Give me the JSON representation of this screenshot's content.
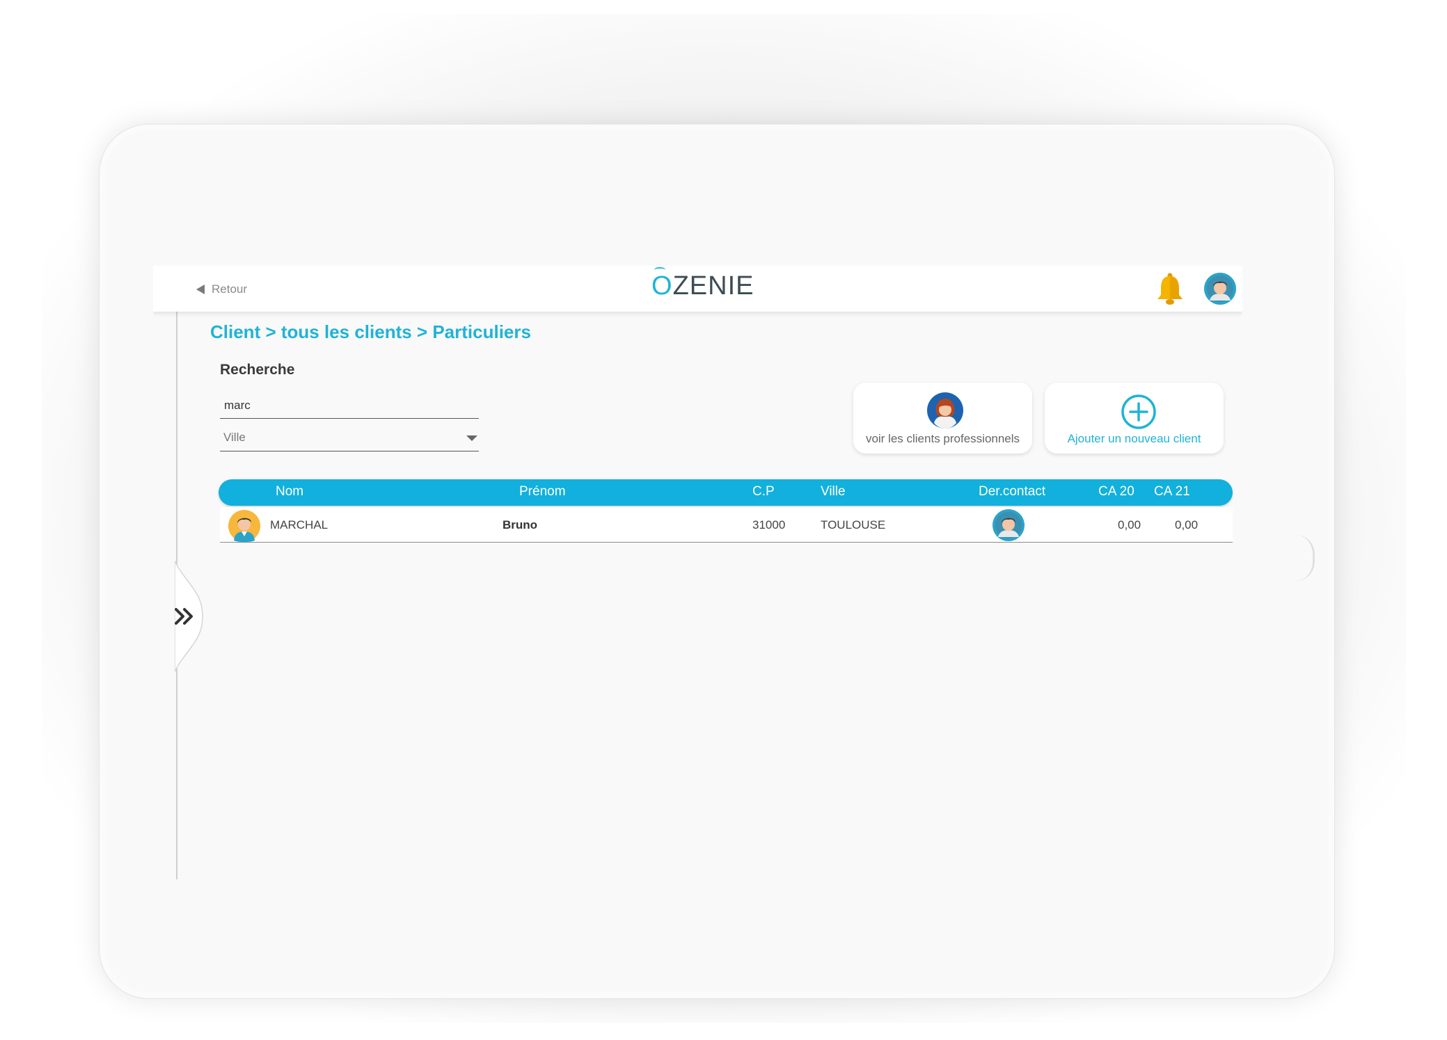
{
  "header": {
    "back_label": "Retour",
    "logo_text": "ZENIE",
    "logo_mark": "O"
  },
  "breadcrumb": "Client > tous les clients > Particuliers",
  "search": {
    "title": "Recherche",
    "query_value": "marc",
    "city_select_value": "Ville"
  },
  "actions": {
    "pro_clients_label": "voir les clients professionnels",
    "add_client_label": "Ajouter un nouveau client"
  },
  "table": {
    "columns": [
      "Nom",
      "Prénom",
      "C.P",
      "Ville",
      "Der.contact",
      "CA 20",
      "CA 21"
    ],
    "rows": [
      {
        "nom": "MARCHAL",
        "prenom": "Bruno",
        "cp": "31000",
        "ville": "TOULOUSE",
        "ca20": "0,00",
        "ca21": "0,00"
      }
    ]
  },
  "colors": {
    "accent": "#1fb3d6",
    "table_header": "#12b0dc",
    "bell": "#f5b400"
  },
  "icons": [
    "back-arrow-icon",
    "bell-icon",
    "user-avatar-icon",
    "female-avatar-icon",
    "plus-circle-icon",
    "chevron-double-right-icon"
  ]
}
